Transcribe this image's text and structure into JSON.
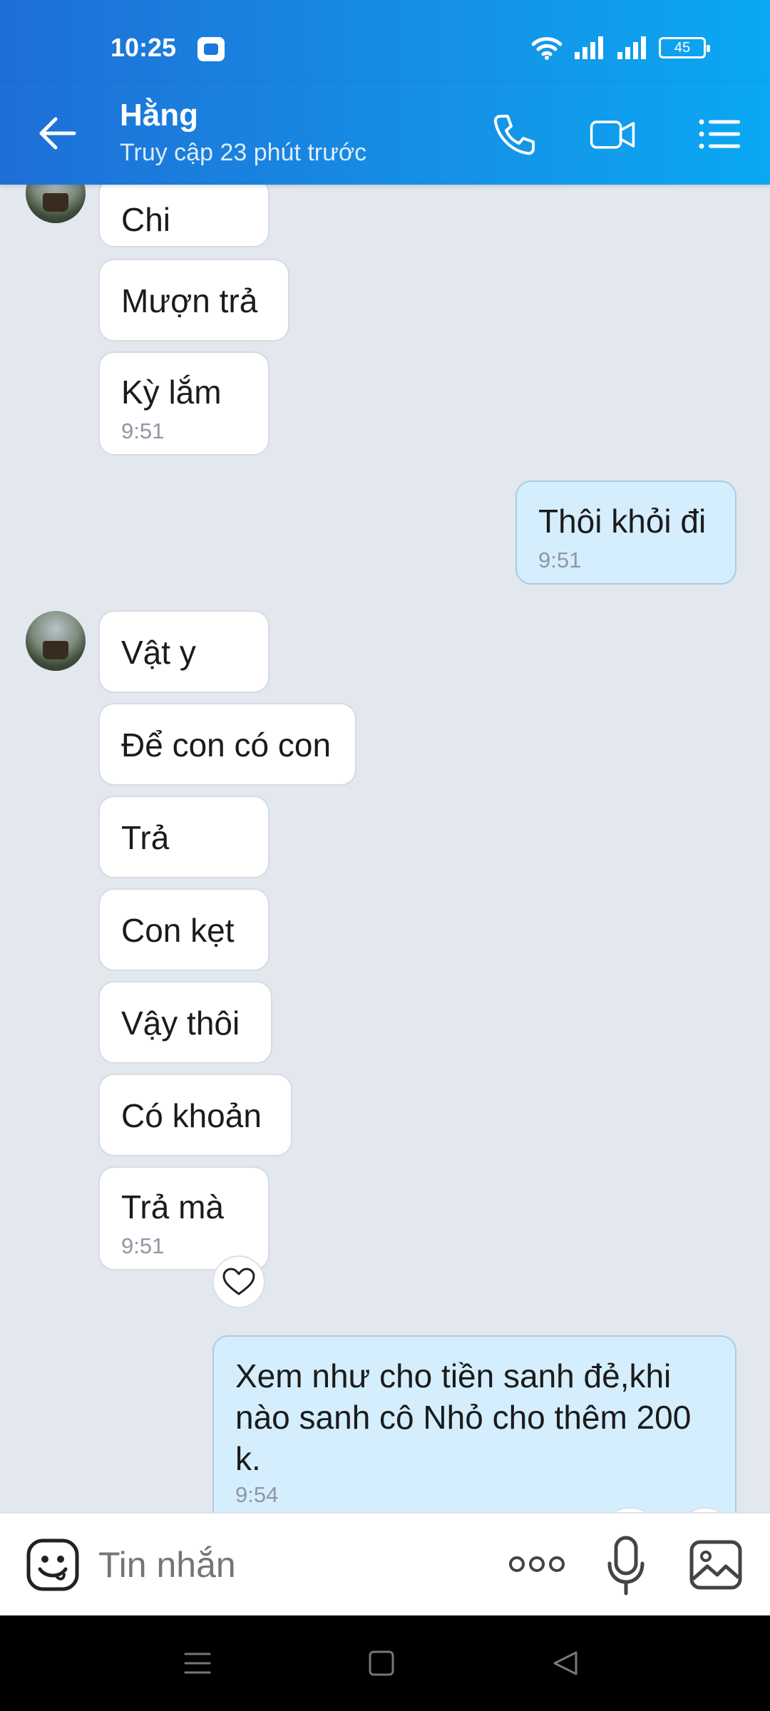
{
  "status_bar": {
    "time": "10:25",
    "battery": "45"
  },
  "header": {
    "name": "Hằng",
    "status": "Truy cập 23 phút trước"
  },
  "messages": [
    {
      "text": "Chi"
    },
    {
      "text": "Mượn trả"
    },
    {
      "text": "Kỳ lắm",
      "time": "9:51"
    },
    {
      "text": "Thôi khỏi đi",
      "time": "9:51"
    },
    {
      "text": "Vật y"
    },
    {
      "text": "Để con có con"
    },
    {
      "text": "Trả"
    },
    {
      "text": "Con kẹt"
    },
    {
      "text": "Vậy thôi"
    },
    {
      "text": "Có khoản"
    },
    {
      "text": "Trả mà",
      "time": "9:51"
    },
    {
      "text": "Xem như cho tiền sanh đẻ,khi nào sanh cô Nhỏ cho thêm 200 k.",
      "time": "9:54"
    }
  ],
  "input": {
    "placeholder": "Tin nhắn"
  }
}
